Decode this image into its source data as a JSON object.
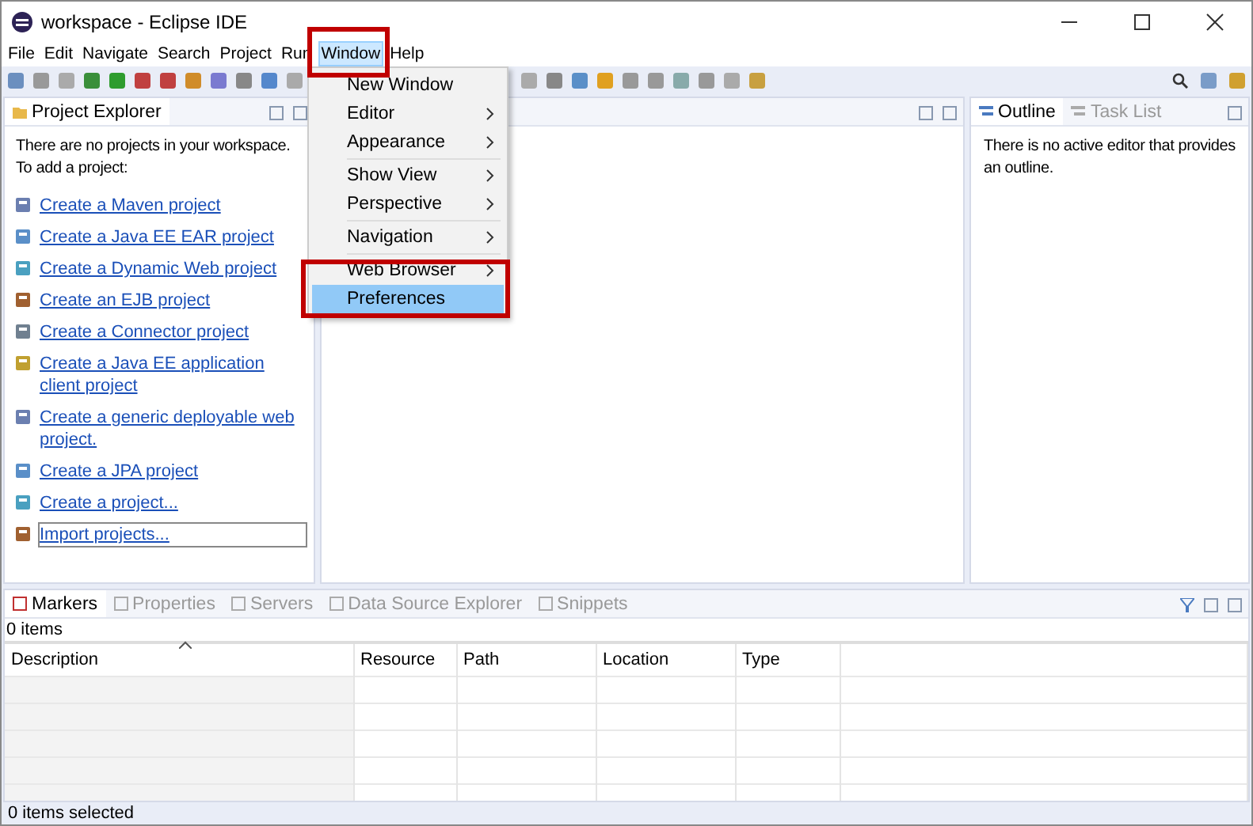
{
  "window": {
    "title": "workspace - Eclipse IDE"
  },
  "menu_bar": [
    {
      "label": "File",
      "selected": false
    },
    {
      "label": "Edit",
      "selected": false
    },
    {
      "label": "Navigate",
      "selected": false
    },
    {
      "label": "Search",
      "selected": false
    },
    {
      "label": "Project",
      "selected": false
    },
    {
      "label": "Run",
      "selected": false
    },
    {
      "label": "Window",
      "selected": true
    },
    {
      "label": "Help",
      "selected": false
    }
  ],
  "window_menu": [
    {
      "kind": "item",
      "label": "New Window",
      "submenu": false,
      "selected": false
    },
    {
      "kind": "item",
      "label": "Editor",
      "submenu": true,
      "selected": false
    },
    {
      "kind": "item",
      "label": "Appearance",
      "submenu": true,
      "selected": false
    },
    {
      "kind": "separator"
    },
    {
      "kind": "item",
      "label": "Show View",
      "submenu": true,
      "selected": false
    },
    {
      "kind": "item",
      "label": "Perspective",
      "submenu": true,
      "selected": false
    },
    {
      "kind": "separator"
    },
    {
      "kind": "item",
      "label": "Navigation",
      "submenu": true,
      "selected": false
    },
    {
      "kind": "separator"
    },
    {
      "kind": "item",
      "label": "Web Browser",
      "submenu": true,
      "selected": false
    },
    {
      "kind": "item",
      "label": "Preferences",
      "submenu": false,
      "selected": true
    }
  ],
  "project_explorer": {
    "tab": "Project Explorer",
    "message_lines": [
      "There are no projects in your workspace.",
      "To add a project:"
    ],
    "links": [
      {
        "label": "Create a Maven project",
        "focused": false
      },
      {
        "label": "Create a Java EE EAR project",
        "focused": false
      },
      {
        "label": "Create a Dynamic Web project",
        "focused": false
      },
      {
        "label": "Create an EJB project",
        "focused": false
      },
      {
        "label": "Create a Connector project",
        "focused": false
      },
      {
        "label": "Create a Java EE application client project",
        "focused": false
      },
      {
        "label": "Create a generic deployable web project.",
        "focused": false
      },
      {
        "label": "Create a JPA project",
        "focused": false
      },
      {
        "label": "Create a project...",
        "focused": false
      },
      {
        "label": "Import projects...",
        "focused": true
      }
    ]
  },
  "outline_panel": {
    "tabs": [
      {
        "label": "Outline",
        "selected": true
      },
      {
        "label": "Task List",
        "selected": false
      }
    ],
    "message": "There is no active editor that provides an outline."
  },
  "bottom_panel": {
    "tabs": [
      {
        "label": "Markers",
        "selected": true
      },
      {
        "label": "Properties",
        "selected": false
      },
      {
        "label": "Servers",
        "selected": false
      },
      {
        "label": "Data Source Explorer",
        "selected": false
      },
      {
        "label": "Snippets",
        "selected": false
      }
    ],
    "count": "0 items",
    "columns": [
      {
        "label": "Description",
        "sorted": true
      },
      {
        "label": "Resource",
        "sorted": false
      },
      {
        "label": "Path",
        "sorted": false
      },
      {
        "label": "Location",
        "sorted": false
      },
      {
        "label": "Type",
        "sorted": false
      }
    ]
  },
  "status_bar": "0 items selected"
}
